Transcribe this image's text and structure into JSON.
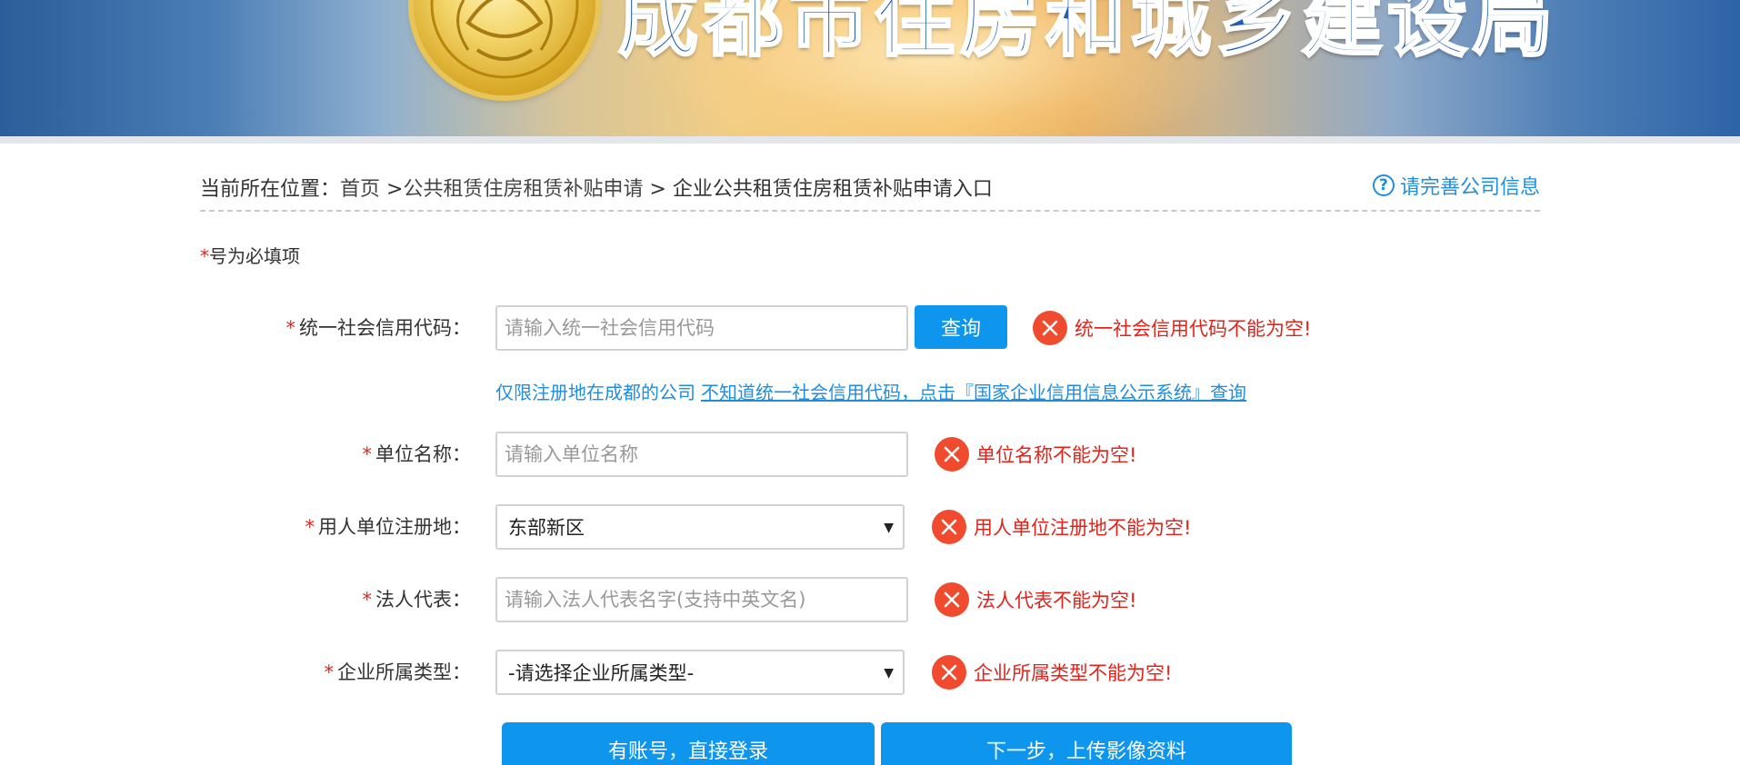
{
  "header": {
    "title": "成都市住房和城乡建设局"
  },
  "breadcrumb": {
    "prefix": "当前所在位置：",
    "home": "首页",
    "sep1": " >",
    "level1": "公共租赁住房租赁补贴申请",
    "sep2": " > ",
    "current": "企业公共租赁住房租赁补贴申请入口"
  },
  "help": {
    "icon_glyph": "?",
    "label": "请完善公司信息"
  },
  "required_note": {
    "star": "*",
    "text": "号为必填项"
  },
  "form": {
    "credit_code": {
      "star": "*",
      "label": "统一社会信用代码：",
      "placeholder": "请输入统一社会信用代码",
      "value": "",
      "query_button": "查询",
      "error": "统一社会信用代码不能为空!"
    },
    "hint": {
      "text": "仅限注册地在成都的公司",
      "link": "不知道统一社会信用代码，点击『国家企业信用信息公示系统』查询"
    },
    "company_name": {
      "star": "*",
      "label": "单位名称：",
      "placeholder": "请输入单位名称",
      "value": "",
      "error": "单位名称不能为空!"
    },
    "registered_place": {
      "star": "*",
      "label": "用人单位注册地：",
      "selected": "东部新区",
      "error": "用人单位注册地不能为空!"
    },
    "legal_rep": {
      "star": "*",
      "label": "法人代表：",
      "placeholder": "请输入法人代表名字(支持中英文名)",
      "value": "",
      "error": "法人代表不能为空!"
    },
    "company_type": {
      "star": "*",
      "label": "企业所属类型：",
      "selected": "-请选择企业所属类型-",
      "error": "企业所属类型不能为空!"
    }
  },
  "buttons": {
    "login": "有账号，直接登录",
    "next": "下一步，上传影像资料"
  },
  "colors": {
    "accent": "#0e96ef",
    "link": "#1f8ee0",
    "error": "#e2231a",
    "error_icon": "#f04b2e"
  }
}
